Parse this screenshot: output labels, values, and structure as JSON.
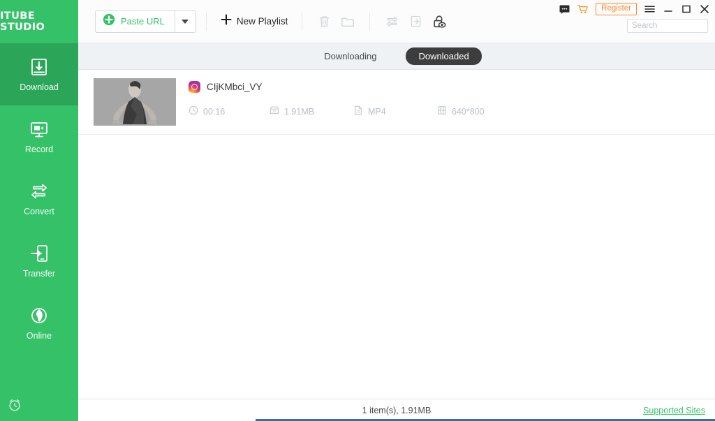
{
  "app": {
    "title": "ITUBE STUDIO"
  },
  "sidebar": {
    "items": [
      {
        "label": "Download",
        "icon": "download-icon",
        "active": true
      },
      {
        "label": "Record",
        "icon": "record-icon",
        "active": false
      },
      {
        "label": "Convert",
        "icon": "convert-icon",
        "active": false
      },
      {
        "label": "Transfer",
        "icon": "transfer-icon",
        "active": false
      },
      {
        "label": "Online",
        "icon": "globe-icon",
        "active": false
      }
    ],
    "bottom_icon": "alarm-clock-icon",
    "bg_color": "#35c168",
    "active_bg_color": "#2ba558"
  },
  "toolbar": {
    "paste_url_label": "Paste URL",
    "paste_url_icon": "plus-circle-icon",
    "paste_dropdown_icon": "caret-down-icon",
    "new_playlist_label": "New Playlist",
    "new_playlist_icon": "plus-icon",
    "icons": [
      {
        "name": "trash-icon",
        "disabled": true
      },
      {
        "name": "folder-icon",
        "disabled": true
      },
      {
        "name": "convert-icon",
        "disabled": true
      },
      {
        "name": "transfer-icon",
        "disabled": true
      },
      {
        "name": "private-mode-lock-eye-icon",
        "disabled": false
      }
    ]
  },
  "window": {
    "feedback_icon": "feedback-bubble-icon",
    "cart_icon": "shopping-cart-icon",
    "register_label": "Register",
    "menu_icon": "hamburger-menu-icon",
    "minimize_icon": "minimize-icon",
    "maximize_icon": "maximize-icon",
    "close_icon": "close-icon",
    "register_color": "#ff8a2a"
  },
  "search": {
    "value": "",
    "placeholder": "Search"
  },
  "tabs": [
    {
      "label": "Downloading",
      "active": false
    },
    {
      "label": "Downloaded",
      "active": true
    }
  ],
  "list": {
    "items": [
      {
        "title": "CIjKMbci_VY",
        "source_icon": "instagram-icon",
        "duration": "00:16",
        "duration_icon": "clock-icon",
        "size": "1.91MB",
        "size_icon": "archive-icon",
        "format": "MP4",
        "format_icon": "document-icon",
        "resolution": "640*800",
        "resolution_icon": "film-icon"
      }
    ]
  },
  "status": {
    "summary": "1 item(s), 1.91MB",
    "supported_sites_label": "Supported Sites",
    "link_color": "#35c168"
  }
}
